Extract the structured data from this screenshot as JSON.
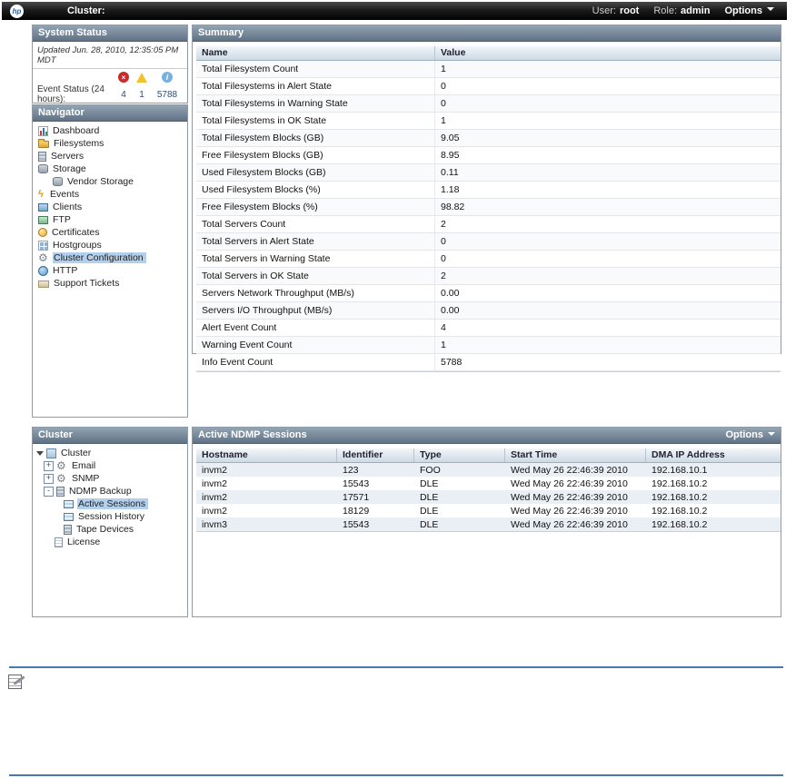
{
  "topbar": {
    "logo_text": "hp",
    "title": "Cluster:",
    "user_label": "User:",
    "user_value": "root",
    "role_label": "Role:",
    "role_value": "admin",
    "options_label": "Options"
  },
  "system_status": {
    "title": "System Status",
    "updated_text": "Updated Jun. 28, 2010, 12:35:05 PM MDT",
    "event_status_label": "Event Status (24 hours):",
    "counts": {
      "alerts": "4",
      "warnings": "1",
      "info": "5788"
    }
  },
  "navigator": {
    "title": "Navigator",
    "items": [
      {
        "label": "Dashboard"
      },
      {
        "label": "Filesystems"
      },
      {
        "label": "Servers"
      },
      {
        "label": "Storage"
      },
      {
        "label": "Vendor Storage"
      },
      {
        "label": "Events"
      },
      {
        "label": "Clients"
      },
      {
        "label": "FTP"
      },
      {
        "label": "Certificates"
      },
      {
        "label": "Hostgroups"
      },
      {
        "label": "Cluster Configuration"
      },
      {
        "label": "HTTP"
      },
      {
        "label": "Support Tickets"
      }
    ]
  },
  "summary": {
    "title": "Summary",
    "columns": [
      "Name",
      "Value"
    ],
    "rows": [
      [
        "Total Filesystem Count",
        "1"
      ],
      [
        "Total Filesystems in Alert State",
        "0"
      ],
      [
        "Total Filesystems in Warning State",
        "0"
      ],
      [
        "Total Filesystems in OK State",
        "1"
      ],
      [
        "Total Filesystem Blocks (GB)",
        "9.05"
      ],
      [
        "Free Filesystem Blocks (GB)",
        "8.95"
      ],
      [
        "Used Filesystem Blocks (GB)",
        "0.11"
      ],
      [
        "Used Filesystem Blocks (%)",
        "1.18"
      ],
      [
        "Free Filesystem Blocks (%)",
        "98.82"
      ],
      [
        "Total Servers Count",
        "2"
      ],
      [
        "Total Servers in Alert State",
        "0"
      ],
      [
        "Total Servers in Warning State",
        "0"
      ],
      [
        "Total Servers in OK State",
        "2"
      ],
      [
        "Servers Network Throughput (MB/s)",
        "0.00"
      ],
      [
        "Servers I/O Throughput (MB/s)",
        "0.00"
      ],
      [
        "Alert Event Count",
        "4"
      ],
      [
        "Warning Event Count",
        "1"
      ],
      [
        "Info Event Count",
        "5788"
      ]
    ]
  },
  "cluster_tree": {
    "title": "Cluster",
    "items": [
      {
        "label": "Cluster"
      },
      {
        "label": "Email"
      },
      {
        "label": "SNMP"
      },
      {
        "label": "NDMP Backup"
      },
      {
        "label": "Active Sessions"
      },
      {
        "label": "Session History"
      },
      {
        "label": "Tape Devices"
      },
      {
        "label": "License"
      }
    ]
  },
  "ndmp_sessions": {
    "title": "Active NDMP Sessions",
    "options_label": "Options",
    "columns": [
      "Hostname",
      "Identifier",
      "Type",
      "Start Time",
      "DMA IP Address"
    ],
    "rows": [
      [
        "invm2",
        "123",
        "FOO",
        "Wed May 26 22:46:39 2010",
        "192.168.10.1"
      ],
      [
        "invm2",
        "15543",
        "DLE",
        "Wed May 26 22:46:39 2010",
        "192.168.10.2"
      ],
      [
        "invm2",
        "17571",
        "DLE",
        "Wed May 26 22:46:39 2010",
        "192.168.10.2"
      ],
      [
        "invm2",
        "18129",
        "DLE",
        "Wed May 26 22:46:39 2010",
        "192.168.10.2"
      ],
      [
        "invm3",
        "15543",
        "DLE",
        "Wed May 26 22:46:39 2010",
        "192.168.10.2"
      ]
    ]
  },
  "colors": {
    "accent_rule": "#4878ae",
    "selection_highlight": "#b2cfeb",
    "panel_header_top": "#93a4b3",
    "panel_header_bottom": "#5f7284",
    "alert_red": "#cc2a2a",
    "warning_yellow": "#f2c12e",
    "info_blue": "#7ab0e0"
  }
}
